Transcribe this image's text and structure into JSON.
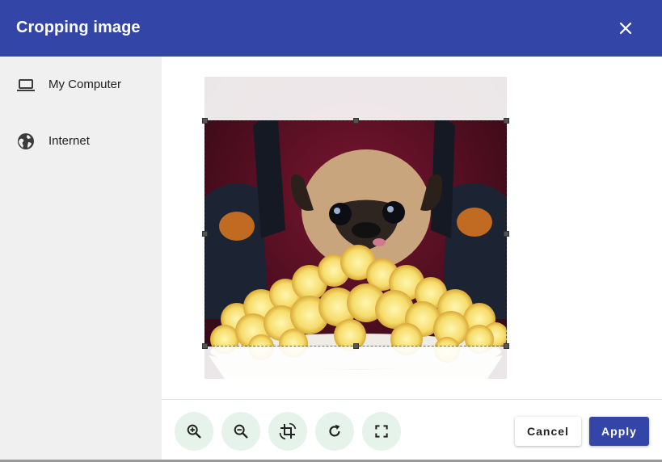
{
  "dialog": {
    "title": "Cropping image",
    "close_icon": "close-icon"
  },
  "sidebar": {
    "items": [
      {
        "label": "My Computer",
        "icon": "laptop-icon"
      },
      {
        "label": "Internet",
        "icon": "globe-icon"
      }
    ]
  },
  "editor": {
    "image_subject": "pug-with-popcorn-image"
  },
  "toolbar": {
    "tools": [
      {
        "icon": "zoom-in-icon"
      },
      {
        "icon": "zoom-out-icon"
      },
      {
        "icon": "crop-rotate-icon"
      },
      {
        "icon": "rotate-icon"
      },
      {
        "icon": "fit-screen-icon"
      }
    ],
    "cancel_label": "Cancel",
    "apply_label": "Apply"
  },
  "colors": {
    "header": "#3346a8",
    "sidebar": "#f0f0f0",
    "tool_bg": "#e6f3ea",
    "apply": "#3346a8"
  }
}
